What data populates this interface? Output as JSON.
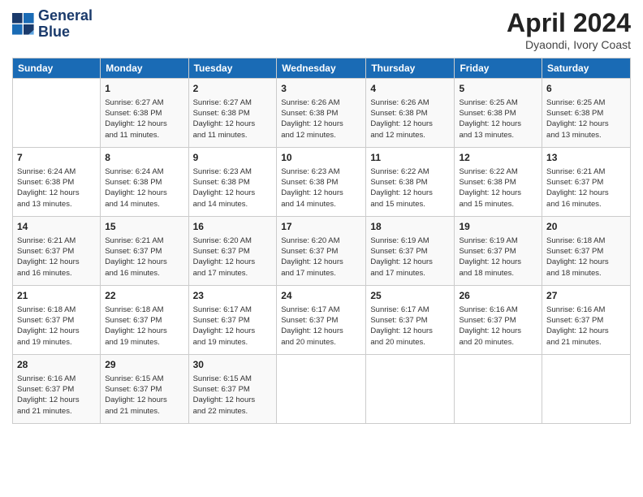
{
  "header": {
    "logo_line1": "General",
    "logo_line2": "Blue",
    "month_title": "April 2024",
    "location": "Dyaondi, Ivory Coast"
  },
  "days_of_week": [
    "Sunday",
    "Monday",
    "Tuesday",
    "Wednesday",
    "Thursday",
    "Friday",
    "Saturday"
  ],
  "weeks": [
    [
      {
        "num": "",
        "info": ""
      },
      {
        "num": "1",
        "info": "Sunrise: 6:27 AM\nSunset: 6:38 PM\nDaylight: 12 hours\nand 11 minutes."
      },
      {
        "num": "2",
        "info": "Sunrise: 6:27 AM\nSunset: 6:38 PM\nDaylight: 12 hours\nand 11 minutes."
      },
      {
        "num": "3",
        "info": "Sunrise: 6:26 AM\nSunset: 6:38 PM\nDaylight: 12 hours\nand 12 minutes."
      },
      {
        "num": "4",
        "info": "Sunrise: 6:26 AM\nSunset: 6:38 PM\nDaylight: 12 hours\nand 12 minutes."
      },
      {
        "num": "5",
        "info": "Sunrise: 6:25 AM\nSunset: 6:38 PM\nDaylight: 12 hours\nand 13 minutes."
      },
      {
        "num": "6",
        "info": "Sunrise: 6:25 AM\nSunset: 6:38 PM\nDaylight: 12 hours\nand 13 minutes."
      }
    ],
    [
      {
        "num": "7",
        "info": "Sunrise: 6:24 AM\nSunset: 6:38 PM\nDaylight: 12 hours\nand 13 minutes."
      },
      {
        "num": "8",
        "info": "Sunrise: 6:24 AM\nSunset: 6:38 PM\nDaylight: 12 hours\nand 14 minutes."
      },
      {
        "num": "9",
        "info": "Sunrise: 6:23 AM\nSunset: 6:38 PM\nDaylight: 12 hours\nand 14 minutes."
      },
      {
        "num": "10",
        "info": "Sunrise: 6:23 AM\nSunset: 6:38 PM\nDaylight: 12 hours\nand 14 minutes."
      },
      {
        "num": "11",
        "info": "Sunrise: 6:22 AM\nSunset: 6:38 PM\nDaylight: 12 hours\nand 15 minutes."
      },
      {
        "num": "12",
        "info": "Sunrise: 6:22 AM\nSunset: 6:38 PM\nDaylight: 12 hours\nand 15 minutes."
      },
      {
        "num": "13",
        "info": "Sunrise: 6:21 AM\nSunset: 6:37 PM\nDaylight: 12 hours\nand 16 minutes."
      }
    ],
    [
      {
        "num": "14",
        "info": "Sunrise: 6:21 AM\nSunset: 6:37 PM\nDaylight: 12 hours\nand 16 minutes."
      },
      {
        "num": "15",
        "info": "Sunrise: 6:21 AM\nSunset: 6:37 PM\nDaylight: 12 hours\nand 16 minutes."
      },
      {
        "num": "16",
        "info": "Sunrise: 6:20 AM\nSunset: 6:37 PM\nDaylight: 12 hours\nand 17 minutes."
      },
      {
        "num": "17",
        "info": "Sunrise: 6:20 AM\nSunset: 6:37 PM\nDaylight: 12 hours\nand 17 minutes."
      },
      {
        "num": "18",
        "info": "Sunrise: 6:19 AM\nSunset: 6:37 PM\nDaylight: 12 hours\nand 17 minutes."
      },
      {
        "num": "19",
        "info": "Sunrise: 6:19 AM\nSunset: 6:37 PM\nDaylight: 12 hours\nand 18 minutes."
      },
      {
        "num": "20",
        "info": "Sunrise: 6:18 AM\nSunset: 6:37 PM\nDaylight: 12 hours\nand 18 minutes."
      }
    ],
    [
      {
        "num": "21",
        "info": "Sunrise: 6:18 AM\nSunset: 6:37 PM\nDaylight: 12 hours\nand 19 minutes."
      },
      {
        "num": "22",
        "info": "Sunrise: 6:18 AM\nSunset: 6:37 PM\nDaylight: 12 hours\nand 19 minutes."
      },
      {
        "num": "23",
        "info": "Sunrise: 6:17 AM\nSunset: 6:37 PM\nDaylight: 12 hours\nand 19 minutes."
      },
      {
        "num": "24",
        "info": "Sunrise: 6:17 AM\nSunset: 6:37 PM\nDaylight: 12 hours\nand 20 minutes."
      },
      {
        "num": "25",
        "info": "Sunrise: 6:17 AM\nSunset: 6:37 PM\nDaylight: 12 hours\nand 20 minutes."
      },
      {
        "num": "26",
        "info": "Sunrise: 6:16 AM\nSunset: 6:37 PM\nDaylight: 12 hours\nand 20 minutes."
      },
      {
        "num": "27",
        "info": "Sunrise: 6:16 AM\nSunset: 6:37 PM\nDaylight: 12 hours\nand 21 minutes."
      }
    ],
    [
      {
        "num": "28",
        "info": "Sunrise: 6:16 AM\nSunset: 6:37 PM\nDaylight: 12 hours\nand 21 minutes."
      },
      {
        "num": "29",
        "info": "Sunrise: 6:15 AM\nSunset: 6:37 PM\nDaylight: 12 hours\nand 21 minutes."
      },
      {
        "num": "30",
        "info": "Sunrise: 6:15 AM\nSunset: 6:37 PM\nDaylight: 12 hours\nand 22 minutes."
      },
      {
        "num": "",
        "info": ""
      },
      {
        "num": "",
        "info": ""
      },
      {
        "num": "",
        "info": ""
      },
      {
        "num": "",
        "info": ""
      }
    ]
  ]
}
